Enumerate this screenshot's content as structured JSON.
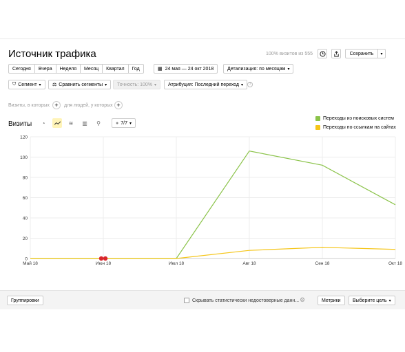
{
  "header": {
    "title": "Источник трафика",
    "visits_percent": "100% визитов из 555",
    "save_label": "Сохранить"
  },
  "period": {
    "buttons": [
      "Сегодня",
      "Вчера",
      "Неделя",
      "Месяц",
      "Квартал",
      "Год"
    ],
    "date_range": "24 мая — 24 окт 2018",
    "detail": "Детализация: по месяцам"
  },
  "filters": {
    "segment": "Сегмент",
    "compare": "Сравнить сегменты",
    "accuracy": "Точность: 100%",
    "attribution": "Атрибуция: Последний переход"
  },
  "segment_row": {
    "visits_in_which": "Визиты, в которых",
    "for_people_which": "для людей, у которых"
  },
  "chart_header": {
    "title": "Визиты",
    "series_count": "7/7"
  },
  "legend": [
    {
      "label": "Переходы из поисковых систем",
      "color": "#8bc34a"
    },
    {
      "label": "Переходы по ссылкам на сайтах",
      "color": "#f5c518"
    }
  ],
  "chart_data": {
    "type": "line",
    "title": "",
    "xlabel": "",
    "ylabel": "",
    "categories": [
      "Май 18",
      "Июн 18",
      "Июл 18",
      "Авг 18",
      "Сен 18",
      "Окт 18"
    ],
    "ylim": [
      0,
      120
    ],
    "yticks": [
      "0",
      "20",
      "40",
      "60",
      "80",
      "100",
      "120"
    ],
    "series": [
      {
        "name": "Переходы из поисковых систем",
        "color": "#8bc34a",
        "values": [
          0,
          0,
          0,
          106,
          92,
          53
        ]
      },
      {
        "name": "Переходы по ссылкам на сайтах",
        "color": "#f5c518",
        "values": [
          0,
          0,
          0,
          8,
          11,
          9
        ]
      }
    ],
    "grid": true,
    "legend": "top-right"
  },
  "footer": {
    "groupings": "Группировки",
    "hide_unreliable": "Скрывать статистически недостоверные данн...",
    "metrics": "Метрики",
    "choose_goal": "Выберите цель"
  }
}
